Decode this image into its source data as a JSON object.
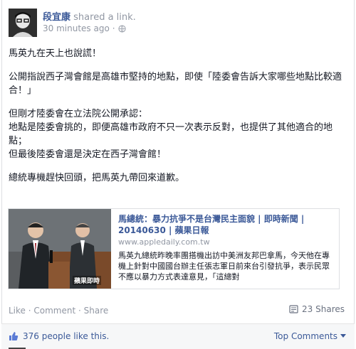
{
  "header": {
    "name": "段宜康",
    "action": "shared a link.",
    "timestamp": "30 minutes ago"
  },
  "body": {
    "lines": [
      "馬英九在天上也說謊！",
      "公開指說西子灣會館是高雄市堅持的地點，即使「陸委會告訴大家哪些地點比較適合！」",
      "但剛才陸委會在立法院公開承認：\n地點是陸委會挑的，即便高雄市政府不只一次表示反對，也提供了其他適合的地點；\n但最後陸委會還是決定在西子灣會館！",
      "總統專機趕快回頭，把馬英九帶回來道歉。"
    ]
  },
  "share": {
    "title": "馬總統：暴力抗爭不是台灣民主面貌 | 即時新聞 | 20140630 | 蘋果日報",
    "url": "www.appledaily.com.tw",
    "description": "馬英九總統昨晚率團搭機出訪中美洲友邦巴拿馬，今天他在專機上針對中國國台辦主任張志軍日前來台引發抗爭，表示民眾不應以暴力方式表達意見，「這總對",
    "image_caption": "蘋果即時"
  },
  "actions": {
    "like": "Like",
    "comment": "Comment",
    "share": "Share",
    "separator": " · "
  },
  "shares": "23 Shares",
  "footer": {
    "likes": "376 people like this.",
    "top_comments": "Top Comments"
  },
  "colors": {
    "link": "#3b5998",
    "muted": "#9197a3",
    "footer_bg": "#f6f7f8"
  }
}
